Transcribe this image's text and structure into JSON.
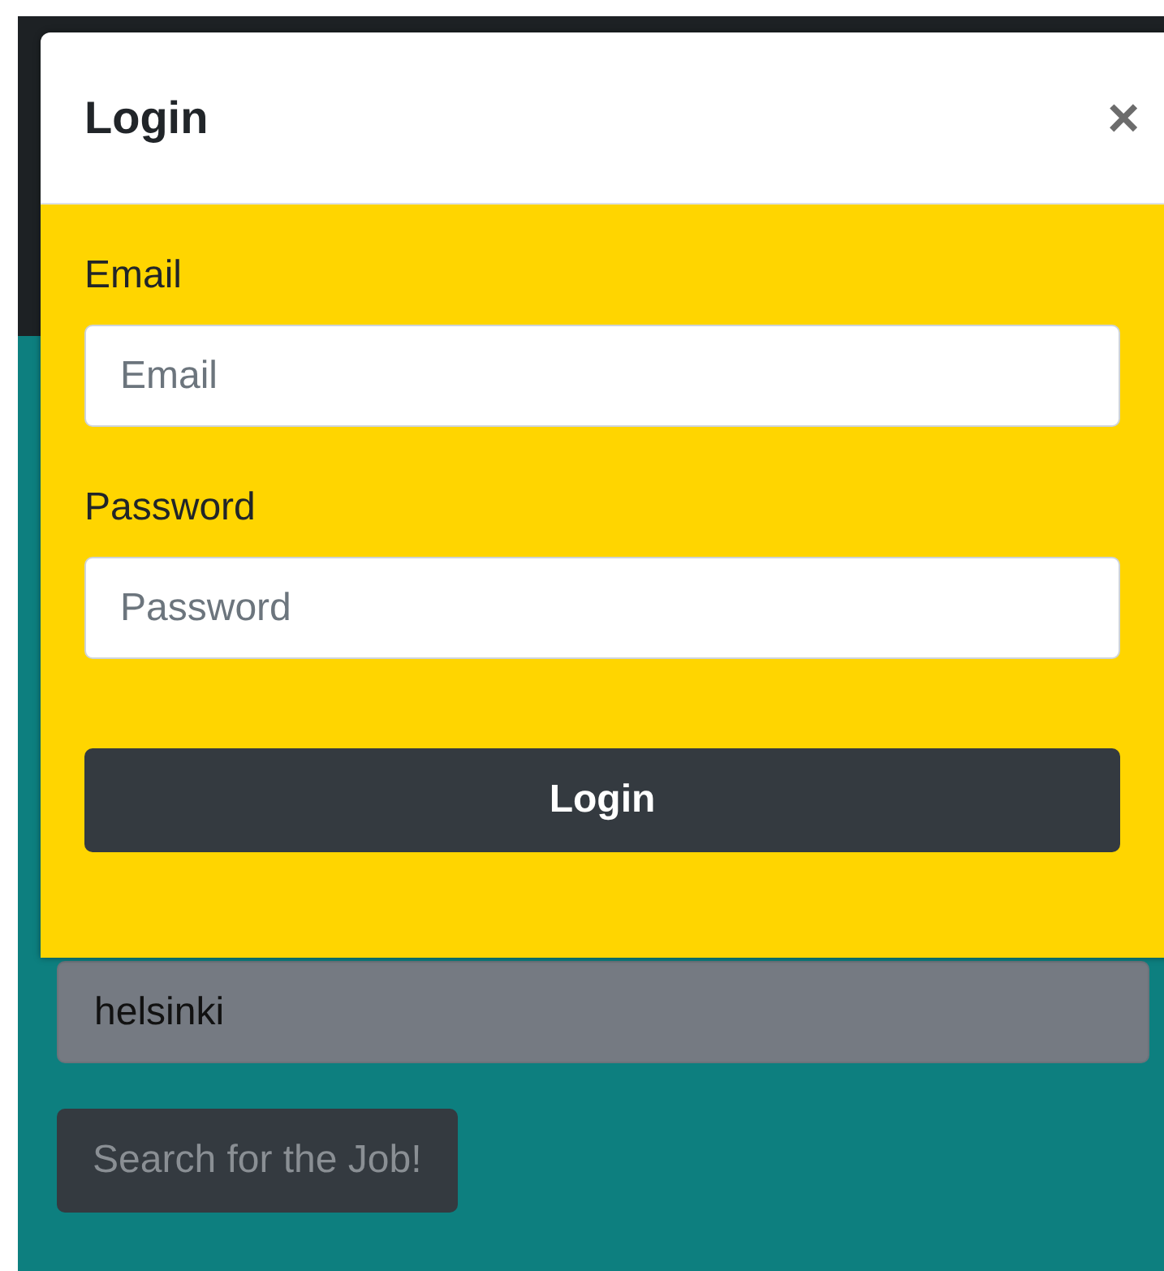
{
  "modal": {
    "title": "Login",
    "close": "×",
    "fields": [
      {
        "label": "Email",
        "placeholder": "Email"
      },
      {
        "label": "Password",
        "placeholder": "Password"
      }
    ],
    "submit": "Login"
  },
  "search": {
    "location": {
      "value": "helsinki"
    },
    "button": {
      "label": "Search for the Job!",
      "disabled": true
    }
  }
}
